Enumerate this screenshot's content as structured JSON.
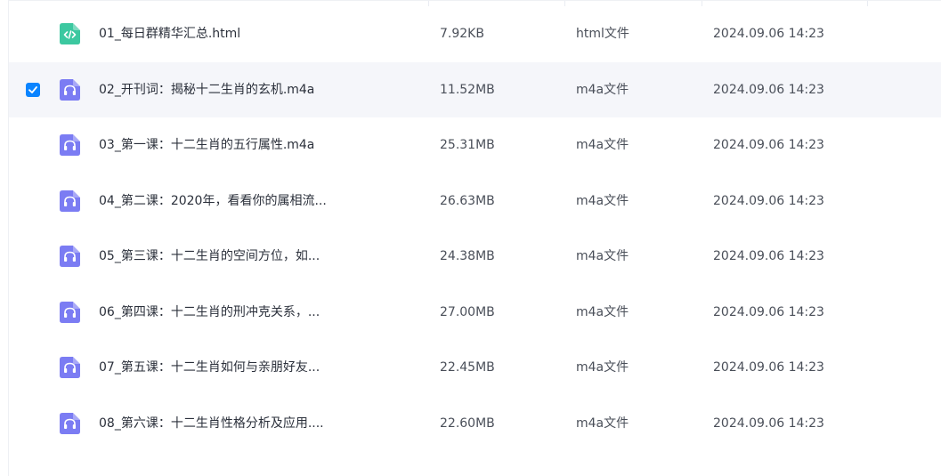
{
  "files": [
    {
      "name": "01_每日群精华汇总.html",
      "size": "7.92KB",
      "type": "html文件",
      "date": "2024.09.06 14:23",
      "icon": "code-file-icon",
      "selected": false
    },
    {
      "name": "02_开刊词：揭秘十二生肖的玄机.m4a",
      "size": "11.52MB",
      "type": "m4a文件",
      "date": "2024.09.06 14:23",
      "icon": "audio-file-icon",
      "selected": true
    },
    {
      "name": "03_第一课：十二生肖的五行属性.m4a",
      "size": "25.31MB",
      "type": "m4a文件",
      "date": "2024.09.06 14:23",
      "icon": "audio-file-icon",
      "selected": false
    },
    {
      "name": "04_第二课：2020年，看看你的属相流...",
      "size": "26.63MB",
      "type": "m4a文件",
      "date": "2024.09.06 14:23",
      "icon": "audio-file-icon",
      "selected": false
    },
    {
      "name": "05_第三课：十二生肖的空间方位，如...",
      "size": "24.38MB",
      "type": "m4a文件",
      "date": "2024.09.06 14:23",
      "icon": "audio-file-icon",
      "selected": false
    },
    {
      "name": "06_第四课：十二生肖的刑冲克关系，...",
      "size": "27.00MB",
      "type": "m4a文件",
      "date": "2024.09.06 14:23",
      "icon": "audio-file-icon",
      "selected": false
    },
    {
      "name": "07_第五课：十二生肖如何与亲朋好友...",
      "size": "22.45MB",
      "type": "m4a文件",
      "date": "2024.09.06 14:23",
      "icon": "audio-file-icon",
      "selected": false
    },
    {
      "name": "08_第六课：十二生肖性格分析及应用....",
      "size": "22.60MB",
      "type": "m4a文件",
      "date": "2024.09.06 14:23",
      "icon": "audio-file-icon",
      "selected": false
    }
  ],
  "colors": {
    "selected_row_bg": "#f5f6fa",
    "checkbox": "#0a84ff",
    "html_icon": "#3cc8a0",
    "audio_icon": "#7b7cf3"
  }
}
